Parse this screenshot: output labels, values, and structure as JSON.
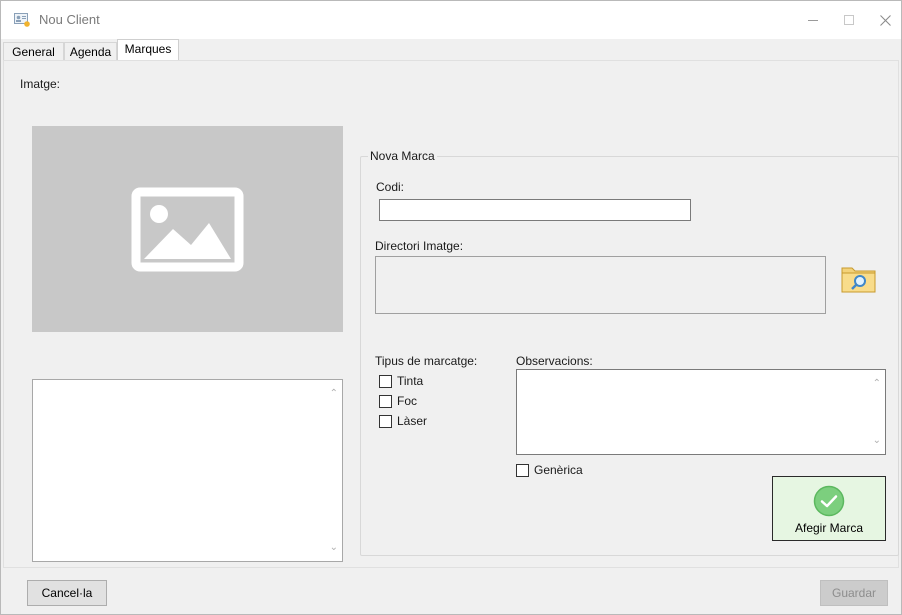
{
  "window": {
    "title": "Nou Client",
    "minimize_icon": "minimize-icon",
    "maximize_icon": "maximize-icon",
    "close_icon": "close-icon"
  },
  "tabs": [
    {
      "label": "General",
      "active": false
    },
    {
      "label": "Agenda",
      "active": false
    },
    {
      "label": "Marques",
      "active": true
    }
  ],
  "marques": {
    "image_label": "Imatge:",
    "image_placeholder_icon": "image-placeholder-icon",
    "group_title": "Nova Marca",
    "codi_label": "Codi:",
    "codi_value": "",
    "directori_label": "Directori Imatge:",
    "directori_value": "",
    "browse_icon": "folder-search-icon",
    "tipus_label": "Tipus de marcatge:",
    "tipus_options": [
      {
        "label": "Tinta",
        "checked": false
      },
      {
        "label": "Foc",
        "checked": false
      },
      {
        "label": "Làser",
        "checked": false
      }
    ],
    "observacions_label": "Observacions:",
    "observacions_value": "",
    "generica_label": "Genèrica",
    "generica_checked": false,
    "add_button_label": "Afegir Marca",
    "add_button_icon": "check-circle-icon"
  },
  "footer": {
    "cancel_label": "Cancel·la",
    "save_label": "Guardar",
    "save_enabled": false
  },
  "colors": {
    "add_button_bg": "#e6f6e2",
    "check_green": "#7ccf7e",
    "image_placeholder_bg": "#c8c8c8"
  }
}
